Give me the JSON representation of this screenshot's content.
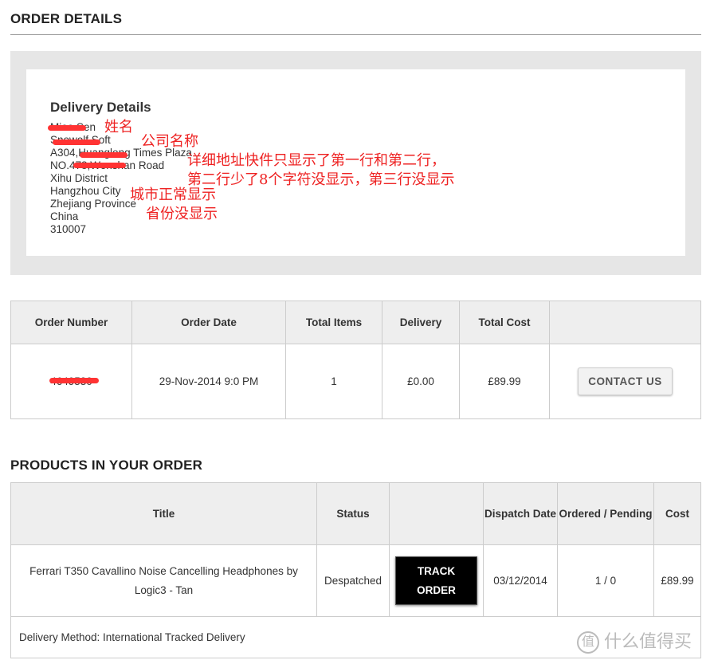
{
  "order_details_heading": "ORDER DETAILS",
  "delivery": {
    "title": "Delivery Details",
    "lines": [
      "Miao Sen",
      "Snowolf Soft",
      "A304,Huanglong Times Plaza",
      "NO.478,Wenshan Road",
      "Xihu District",
      "Hangzhou City",
      "Zhejiang Province",
      "China",
      "310007"
    ]
  },
  "annotations": {
    "name": "姓名",
    "company": "公司名称",
    "address_1": "详细地址快件只显示了第一行和第二行，",
    "address_2": "第二行少了8个字符没显示，第三行没显示",
    "city": "城市正常显示",
    "province": "省份没显示"
  },
  "order_table": {
    "headers": [
      "Order Number",
      "Order Date",
      "Total Items",
      "Delivery",
      "Total Cost",
      ""
    ],
    "row": {
      "order_number": "4649530",
      "order_date": "29-Nov-2014 9:0 PM",
      "total_items": "1",
      "delivery": "£0.00",
      "total_cost": "£89.99",
      "contact_label": "CONTACT US"
    }
  },
  "products_heading": "PRODUCTS IN YOUR ORDER",
  "products_table": {
    "headers": [
      "Title",
      "Status",
      "",
      "Dispatch Date",
      "Ordered / Pending",
      "Cost"
    ],
    "row": {
      "title": "Ferrari T350 Cavallino Noise Cancelling Headphones by Logic3 - Tan",
      "status": "Despatched",
      "track_label_1": "TRACK",
      "track_label_2": "ORDER",
      "dispatch_date": "03/12/2014",
      "ordered_pending": "1 / 0",
      "cost": "£89.99"
    },
    "delivery_method": "Delivery Method: International Tracked Delivery"
  },
  "watermark": {
    "badge": "值",
    "text": "什么值得买"
  },
  "colors": {
    "annotation": "#ee2222",
    "scribble": "#ff3333"
  }
}
